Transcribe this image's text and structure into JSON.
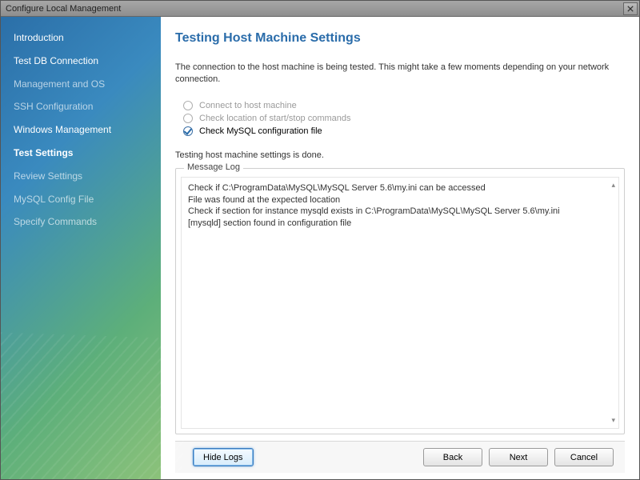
{
  "window": {
    "title": "Configure Local Management"
  },
  "sidebar": {
    "items": [
      {
        "label": "Introduction",
        "state": "done"
      },
      {
        "label": "Test DB Connection",
        "state": "done"
      },
      {
        "label": "Management and OS",
        "state": "pending"
      },
      {
        "label": "SSH Configuration",
        "state": "pending"
      },
      {
        "label": "Windows Management",
        "state": "done"
      },
      {
        "label": "Test Settings",
        "state": "current"
      },
      {
        "label": "Review Settings",
        "state": "pending"
      },
      {
        "label": "MySQL Config File",
        "state": "pending"
      },
      {
        "label": "Specify Commands",
        "state": "pending"
      }
    ]
  },
  "main": {
    "title": "Testing Host Machine Settings",
    "intro": "The connection to the host machine is being tested. This might take a few moments depending on your network connection.",
    "checks": [
      {
        "label": "Connect to host machine",
        "done": false,
        "disabled": true
      },
      {
        "label": "Check location of start/stop commands",
        "done": false,
        "disabled": true
      },
      {
        "label": "Check MySQL configuration file",
        "done": true,
        "disabled": false
      }
    ],
    "status": "Testing host machine settings is done.",
    "message_log": {
      "legend": "Message Log",
      "lines": [
        "Check if C:\\ProgramData\\MySQL\\MySQL Server 5.6\\my.ini can be accessed",
        "File was found at the expected location",
        "Check if section for instance mysqld exists in C:\\ProgramData\\MySQL\\MySQL Server 5.6\\my.ini",
        "[mysqld] section found in configuration file"
      ]
    }
  },
  "footer": {
    "hide_logs": "Hide Logs",
    "back": "Back",
    "next": "Next",
    "cancel": "Cancel"
  }
}
